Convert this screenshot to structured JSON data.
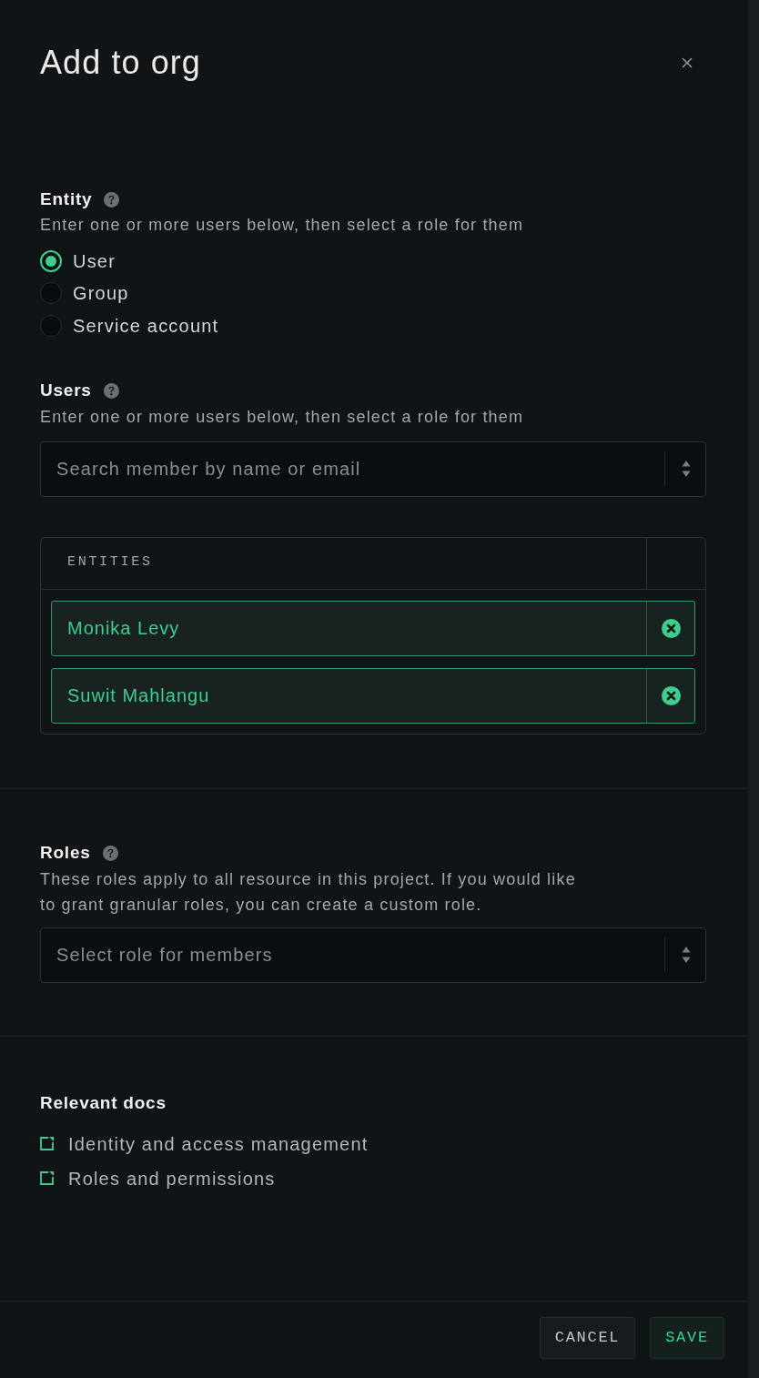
{
  "dialog": {
    "title": "Add to org"
  },
  "entity": {
    "label": "Entity",
    "description": "Enter one or more users below, then select a role for them",
    "options": [
      {
        "label": "User",
        "selected": true
      },
      {
        "label": "Group",
        "selected": false
      },
      {
        "label": "Service account",
        "selected": false
      }
    ]
  },
  "users": {
    "label": "Users",
    "description": "Enter one or more users below, then select a role for them",
    "search": {
      "placeholder": "Search member by name or email"
    },
    "table": {
      "columns": [
        "ENTITIES"
      ],
      "rows": [
        {
          "name": "Monika Levy"
        },
        {
          "name": "Suwit Mahlangu"
        }
      ]
    }
  },
  "roles": {
    "label": "Roles",
    "description": "These roles apply to all resource in this project. If you would like to grant granular roles, you can create a custom role.",
    "select": {
      "placeholder": "Select role for members"
    }
  },
  "docs": {
    "title": "Relevant docs",
    "links": [
      "Identity and access management",
      "Roles and permissions"
    ]
  },
  "buttons": [
    {
      "label": "CANCEL",
      "kind": "secondary"
    },
    {
      "label": "SAVE",
      "kind": "primary"
    }
  ]
}
